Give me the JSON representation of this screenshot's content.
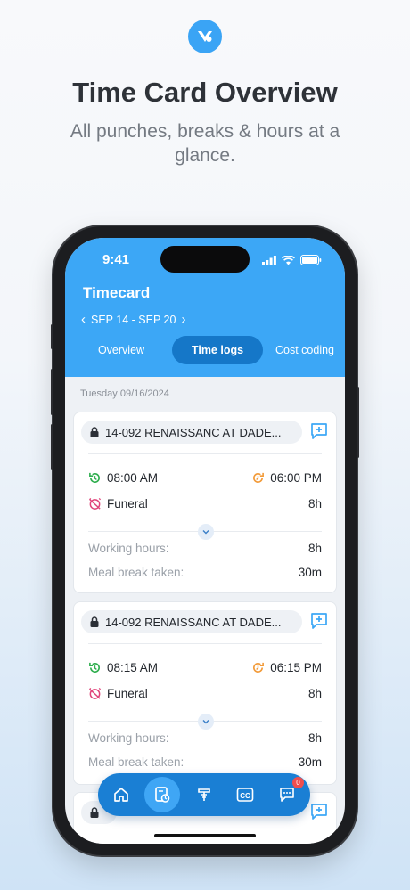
{
  "promo": {
    "headline": "Time Card Overview",
    "subline": "All punches, breaks & hours at a glance."
  },
  "status_bar": {
    "time": "9:41"
  },
  "header": {
    "title": "Timecard",
    "week_range": "SEP 14 - SEP 20"
  },
  "tabs": [
    {
      "label": "Overview",
      "active": false
    },
    {
      "label": "Time logs",
      "active": true
    },
    {
      "label": "Cost coding",
      "active": false
    }
  ],
  "date_label": "Tuesday 09/16/2024",
  "entries": [
    {
      "job": "14-092 RENAISSANC AT DADE...",
      "clock_in": "08:00 AM",
      "clock_out": "06:00 PM",
      "type": "Funeral",
      "type_hours": "8h",
      "working_hours_label": "Working hours:",
      "working_hours": "8h",
      "meal_break_label": "Meal break taken:",
      "meal_break": "30m"
    },
    {
      "job": "14-092 RENAISSANC AT DADE...",
      "clock_in": "08:15 AM",
      "clock_out": "06:15 PM",
      "type": "Funeral",
      "type_hours": "8h",
      "working_hours_label": "Working hours:",
      "working_hours": "8h",
      "meal_break_label": "Meal break taken:",
      "meal_break": "30m"
    }
  ],
  "bottom_nav": {
    "items": [
      "home-icon",
      "timecard-icon",
      "cost-code-icon",
      "cc-icon",
      "chat-icon"
    ],
    "active": "timecard-icon",
    "chat_badge": "0"
  },
  "colors": {
    "brand": "#3ca7f6",
    "active_tab": "#1577c8",
    "nav": "#1a7fd4",
    "clock_in": "#2fae4e",
    "clock_out": "#f29a38",
    "leave": "#e0457b",
    "badge": "#ef4e4e"
  }
}
